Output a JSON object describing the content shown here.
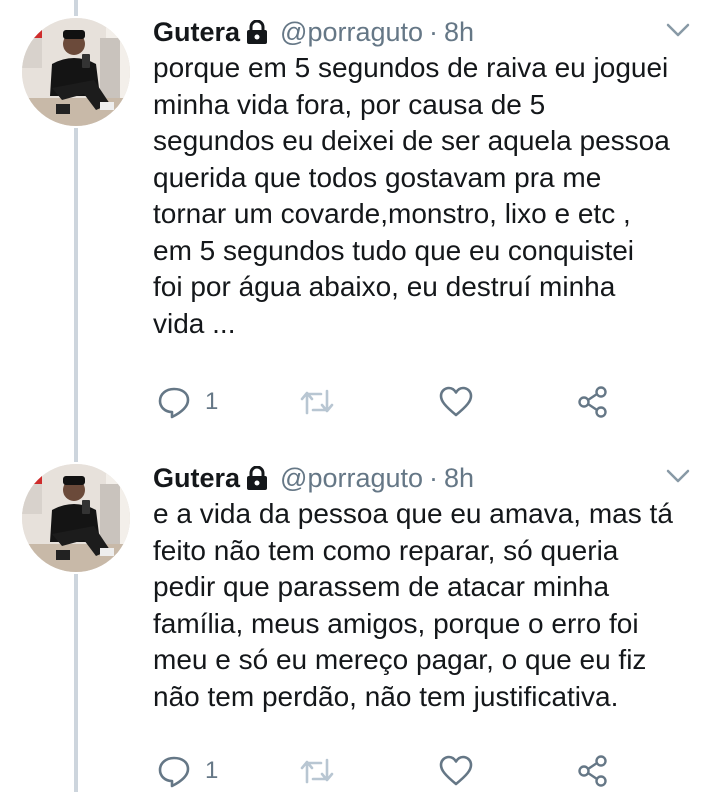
{
  "tweets": [
    {
      "name": "Gutera",
      "handle": "@porraguto",
      "separator": "·",
      "time": "8h",
      "text": "porque em 5 segundos de raiva eu joguei\nminha vida fora, por causa de 5\nsegundos eu deixei de ser aquela pessoa\nquerida que todos gostavam pra me\ntornar um covarde,monstro, lixo e etc ,\nem 5 segundos tudo que eu conquistei\nfoi por água abaixo, eu destruí minha\nvida ...",
      "reply_count": "1"
    },
    {
      "name": "Gutera",
      "handle": "@porraguto",
      "separator": "·",
      "time": "8h",
      "text": "e a vida da pessoa que eu amava, mas tá\nfeito não tem como reparar, só queria\npedir que parassem de atacar minha\nfamília, meus amigos, porque o erro foi\nmeu e só eu mereço pagar, o que eu fiz\nnão tem perdão, não tem justificativa.",
      "reply_count": "1"
    }
  ],
  "icons": {
    "lock": "lock-icon",
    "caret": "chevron-down-icon",
    "reply": "reply-icon",
    "retweet": "retweet-icon",
    "like": "heart-icon",
    "share": "share-icon"
  },
  "colors": {
    "text": "#14171a",
    "secondary": "#657786",
    "thread_line": "#cdd5dd",
    "retweet_disabled": "#b8c6d2"
  }
}
